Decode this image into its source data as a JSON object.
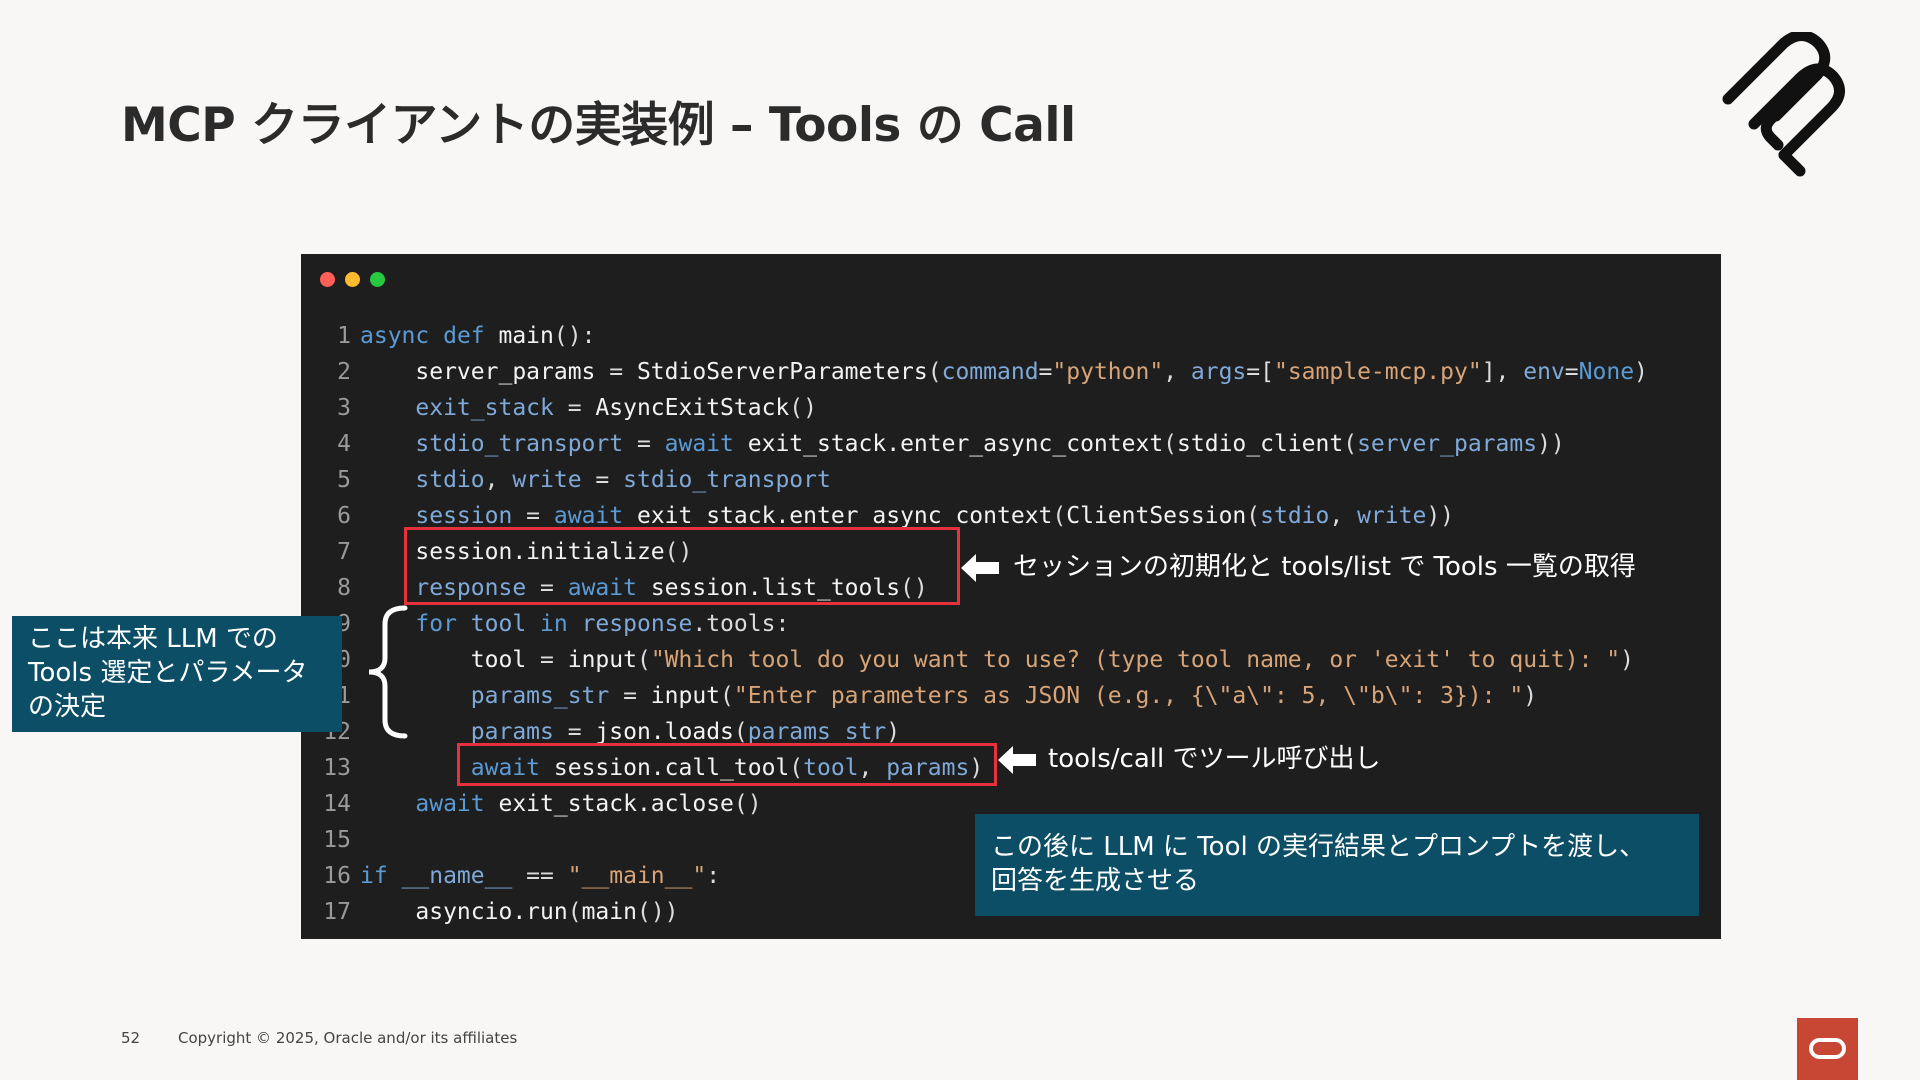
{
  "slide": {
    "title": "MCP クライアントの実装例 – Tools の Call",
    "page_number": "52",
    "copyright": "Copyright © 2025, Oracle and/or its affiliates"
  },
  "code": {
    "lines": [
      {
        "n": "1",
        "segments": [
          [
            "kw",
            "async "
          ],
          [
            "kw",
            "def "
          ],
          [
            "fn",
            "main"
          ],
          [
            "op",
            "():"
          ]
        ]
      },
      {
        "n": "2",
        "segments": [
          [
            "fn",
            "    server_params"
          ],
          [
            "op",
            " = "
          ],
          [
            "fn",
            "StdioServerParameters"
          ],
          [
            "op",
            "("
          ],
          [
            "vr",
            "command"
          ],
          [
            "op",
            "="
          ],
          [
            "st",
            "\"python\""
          ],
          [
            "op",
            ", "
          ],
          [
            "vr",
            "args"
          ],
          [
            "op",
            "=["
          ],
          [
            "st",
            "\"sample-mcp.py\""
          ],
          [
            "op",
            "], "
          ],
          [
            "vr",
            "env"
          ],
          [
            "op",
            "="
          ],
          [
            "kw",
            "None"
          ],
          [
            "op",
            ")"
          ]
        ]
      },
      {
        "n": "3",
        "segments": [
          [
            "vr",
            "    exit_stack"
          ],
          [
            "op",
            " = "
          ],
          [
            "fn",
            "AsyncExitStack"
          ],
          [
            "op",
            "()"
          ]
        ]
      },
      {
        "n": "4",
        "segments": [
          [
            "vr",
            "    stdio_transport"
          ],
          [
            "op",
            " = "
          ],
          [
            "kw",
            "await "
          ],
          [
            "fn",
            "exit_stack.enter_async_context"
          ],
          [
            "op",
            "("
          ],
          [
            "fn",
            "stdio_client"
          ],
          [
            "op",
            "("
          ],
          [
            "vr",
            "server_params"
          ],
          [
            "op",
            "))"
          ]
        ]
      },
      {
        "n": "5",
        "segments": [
          [
            "vr",
            "    stdio"
          ],
          [
            "op",
            ", "
          ],
          [
            "vr",
            "write"
          ],
          [
            "op",
            " = "
          ],
          [
            "vr",
            "stdio_transport"
          ]
        ]
      },
      {
        "n": "6",
        "segments": [
          [
            "vr",
            "    session"
          ],
          [
            "op",
            " = "
          ],
          [
            "kw",
            "await "
          ],
          [
            "fn",
            "exit_stack.enter_async_context"
          ],
          [
            "op",
            "("
          ],
          [
            "fn",
            "ClientSession"
          ],
          [
            "op",
            "("
          ],
          [
            "vr",
            "stdio"
          ],
          [
            "op",
            ", "
          ],
          [
            "vr",
            "write"
          ],
          [
            "op",
            "))"
          ]
        ]
      },
      {
        "n": "7",
        "segments": [
          [
            "fn",
            "    session.initialize"
          ],
          [
            "op",
            "()"
          ]
        ]
      },
      {
        "n": "8",
        "segments": [
          [
            "vr",
            "    response"
          ],
          [
            "op",
            " = "
          ],
          [
            "kw",
            "await "
          ],
          [
            "fn",
            "session.list_tools"
          ],
          [
            "op",
            "()"
          ]
        ]
      },
      {
        "n": "9",
        "segments": [
          [
            "kw",
            "    for "
          ],
          [
            "vr",
            "tool "
          ],
          [
            "kw",
            "in "
          ],
          [
            "vr",
            "response"
          ],
          [
            "op",
            ".tools:"
          ]
        ]
      },
      {
        "n": "10",
        "segments": [
          [
            "fn",
            "        tool"
          ],
          [
            "op",
            " = "
          ],
          [
            "fn",
            "input"
          ],
          [
            "op",
            "("
          ],
          [
            "st",
            "\"Which tool do you want to use? (type tool name, or 'exit' to quit): \""
          ],
          [
            "op",
            ")"
          ]
        ]
      },
      {
        "n": "11",
        "segments": [
          [
            "vr",
            "        params_str"
          ],
          [
            "op",
            " = "
          ],
          [
            "fn",
            "input"
          ],
          [
            "op",
            "("
          ],
          [
            "st",
            "\"Enter parameters as JSON (e.g., {\\\"a\\\": 5, \\\"b\\\": 3}): \""
          ],
          [
            "op",
            ")"
          ]
        ]
      },
      {
        "n": "12",
        "segments": [
          [
            "vr",
            "        params"
          ],
          [
            "op",
            " = "
          ],
          [
            "fn",
            "json.loads"
          ],
          [
            "op",
            "("
          ],
          [
            "vr",
            "params_str"
          ],
          [
            "op",
            ")"
          ]
        ]
      },
      {
        "n": "13",
        "segments": [
          [
            "kw",
            "        await "
          ],
          [
            "fn",
            "session.call_tool"
          ],
          [
            "op",
            "("
          ],
          [
            "vr",
            "tool"
          ],
          [
            "op",
            ", "
          ],
          [
            "vr",
            "params"
          ],
          [
            "op",
            ")"
          ]
        ]
      },
      {
        "n": "14",
        "segments": [
          [
            "kw",
            "    await "
          ],
          [
            "fn",
            "exit_stack.aclose"
          ],
          [
            "op",
            "()"
          ]
        ]
      },
      {
        "n": "15",
        "segments": []
      },
      {
        "n": "16",
        "segments": [
          [
            "kw",
            "if "
          ],
          [
            "vr",
            "__name__"
          ],
          [
            "op",
            " == "
          ],
          [
            "st",
            "\"__main__\""
          ],
          [
            "op",
            ":"
          ]
        ]
      },
      {
        "n": "17",
        "segments": [
          [
            "fn",
            "    asyncio.run"
          ],
          [
            "op",
            "("
          ],
          [
            "fn",
            "main"
          ],
          [
            "op",
            "())"
          ]
        ]
      }
    ]
  },
  "annotations": {
    "init_list": "セッションの初期化と tools/list で Tools 一覧の取得",
    "call": "tools/call でツール呼び出し",
    "after_note": [
      "この後に LLM に Tool の実行結果とプロンプトを渡し、",
      "回答を生成させる"
    ],
    "left_note": [
      "ここは本来 LLM での",
      "Tools 選定とパラメータ",
      "の決定"
    ]
  },
  "colors": {
    "background": "#f8f7f5",
    "code_bg": "#1e1e1e",
    "highlight": "#e5323c",
    "note_bg": "#0b4e66",
    "oracle_red": "#c74634"
  }
}
